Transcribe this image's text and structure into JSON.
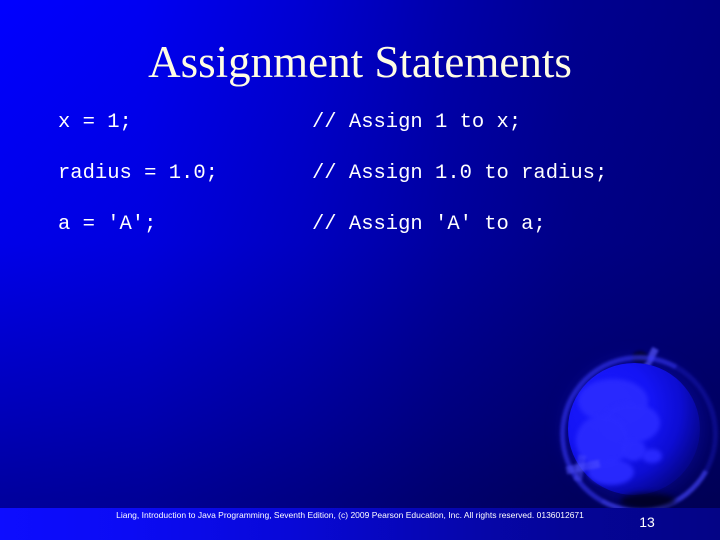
{
  "slide": {
    "title": "Assignment Statements",
    "background": {
      "gradient_from": "#0000ff",
      "gradient_to": "#000082"
    },
    "title_color": "#fffde4",
    "code_color": "#ffffff"
  },
  "code_lines": [
    {
      "statement": "x = 1;",
      "comment": "// Assign 1 to x;"
    },
    {
      "statement": "radius = 1.0;",
      "comment": "// Assign 1.0 to radius;"
    },
    {
      "statement": "a = 'A';",
      "comment": "// Assign 'A' to a;"
    }
  ],
  "footer": {
    "credit": "Liang, Introduction to Java Programming, Seventh Edition, (c) 2009 Pearson Education, Inc. All rights reserved. 0136012671",
    "page_number": "13"
  },
  "decoration": {
    "globe_icon": "globe-icon"
  }
}
